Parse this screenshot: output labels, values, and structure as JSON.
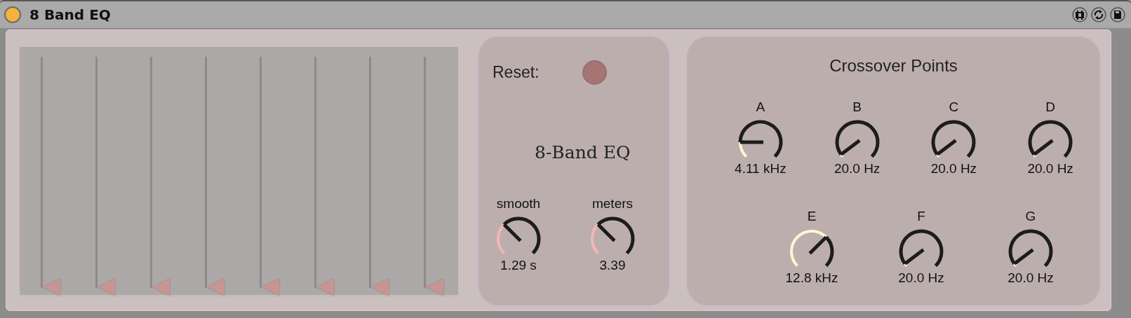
{
  "window": {
    "title": "8 Band EQ"
  },
  "title_icons": [
    {
      "kind": "frame"
    },
    {
      "kind": "swap"
    },
    {
      "kind": "save"
    }
  ],
  "sliders": [
    {
      "level": 0
    },
    {
      "level": 0
    },
    {
      "level": 0
    },
    {
      "level": 0
    },
    {
      "level": 0
    },
    {
      "level": 0
    },
    {
      "level": 0
    },
    {
      "level": 0
    }
  ],
  "reset": {
    "label": "Reset:"
  },
  "device_name": "8-Band EQ",
  "controls": [
    {
      "label": "smooth",
      "value": "1.29 s"
    },
    {
      "label": "meters",
      "value": "3.39"
    }
  ],
  "crossover": {
    "title": "Crossover Points",
    "rows": [
      [
        {
          "label": "A",
          "value": "4.11 kHz"
        },
        {
          "label": "B",
          "value": "20.0 Hz"
        },
        {
          "label": "C",
          "value": "20.0 Hz"
        },
        {
          "label": "D",
          "value": "20.0 Hz"
        }
      ],
      [
        {
          "label": "E",
          "value": "12.8 kHz"
        },
        {
          "label": "F",
          "value": "20.0 Hz"
        },
        {
          "label": "G",
          "value": "20.0 Hz"
        }
      ]
    ]
  }
}
